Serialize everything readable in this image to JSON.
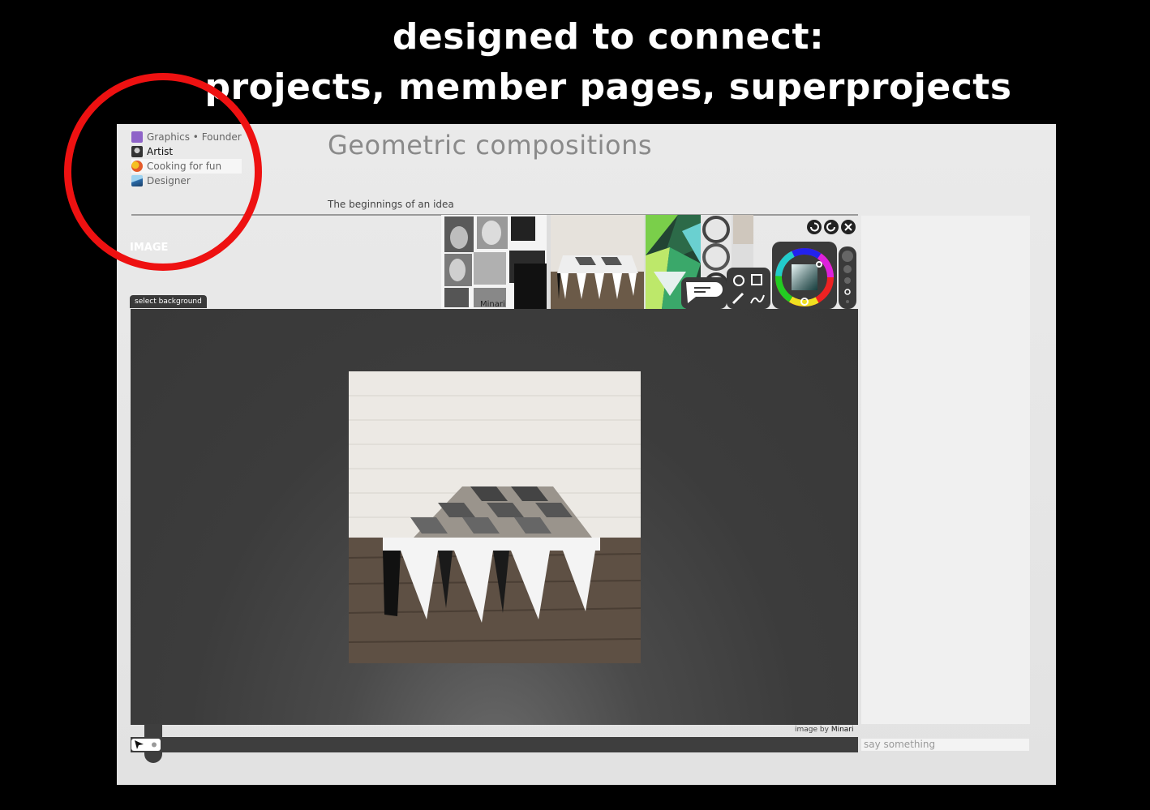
{
  "headline": {
    "line1": "designed to connect:",
    "line2": "projects, member pages, superprojects"
  },
  "roles": [
    {
      "label": "Graphics • Founder",
      "icon": "graphics-icon",
      "color": "#8e63c8"
    },
    {
      "label": "Artist",
      "icon": "artist-avatar-icon",
      "color": "#333333"
    },
    {
      "label": "Cooking for fun",
      "icon": "cooking-icon",
      "color": "#e55b2a"
    },
    {
      "label": "Designer",
      "icon": "designer-icon",
      "color": "#2a6aa8"
    }
  ],
  "project": {
    "title": "Geometric compositions",
    "subtitle": "The beginnings of an idea"
  },
  "panel": {
    "image_label": "IMAGE",
    "select_background": "select background"
  },
  "thumbnails": [
    {
      "name": "collage-thumbnail",
      "label": "Minari"
    },
    {
      "name": "stool-thumbnail",
      "label": ""
    },
    {
      "name": "green-geometric-thumbnail",
      "label": ""
    },
    {
      "name": "circles-thumbnail",
      "label": ""
    },
    {
      "name": "small-thumbnail",
      "label": ""
    }
  ],
  "caption": {
    "prefix": "image by",
    "author": "Minari"
  },
  "comment": {
    "placeholder": "say something"
  },
  "colors": {
    "annotation": "#ee1111",
    "canvas": "#3c3c3c",
    "background": "#000000"
  }
}
